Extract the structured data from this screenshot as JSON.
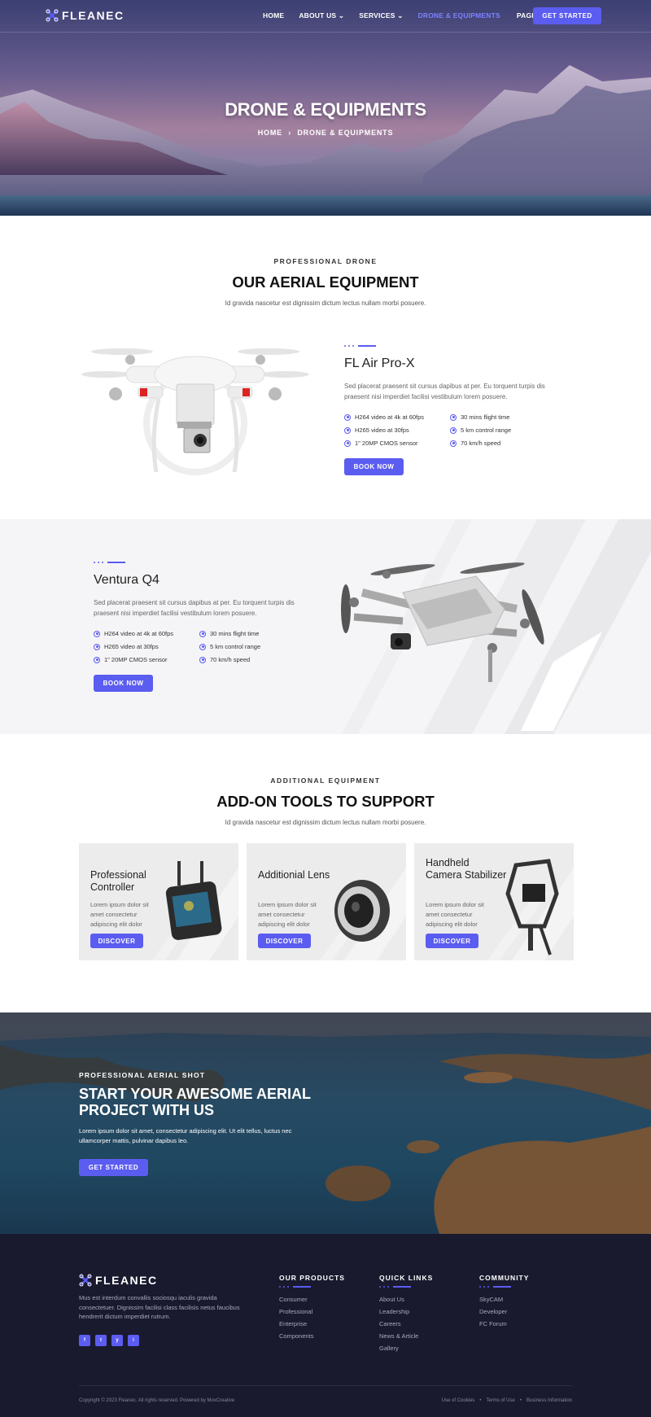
{
  "brand": {
    "name": "FLEANEC"
  },
  "nav": {
    "items": [
      {
        "label": "HOME"
      },
      {
        "label": "ABOUT US",
        "dropdown": true
      },
      {
        "label": "SERVICES",
        "dropdown": true
      },
      {
        "label": "DRONE & EQUIPMENTS",
        "active": true
      },
      {
        "label": "PAGES",
        "dropdown": true
      }
    ],
    "cta": "GET STARTED"
  },
  "hero": {
    "title": "DRONE & EQUIPMENTS",
    "breadcrumb": {
      "home": "HOME",
      "sep": "›",
      "current": "DRONE & EQUIPMENTS"
    }
  },
  "aerial": {
    "kicker": "PROFESSIONAL DRONE",
    "title": "OUR AERIAL EQUIPMENT",
    "subtitle": "Id gravida nascetur est dignissim dictum lectus nullam morbi posuere."
  },
  "products": [
    {
      "title": "FL Air Pro-X",
      "desc": "Sed placerat praesent sit cursus dapibus at per. Eu torquent turpis dis praesent nisi imperdiet facilisi vestibulum lorem posuere.",
      "features": [
        "H264 video at 4k at 60fps",
        "30 mins flight time",
        "H265 video at 30fps",
        "5 km control range",
        "1\" 20MP CMOS sensor",
        "70 km/h speed"
      ],
      "button": "BOOK NOW"
    },
    {
      "title": "Ventura Q4",
      "desc": "Sed placerat praesent sit cursus dapibus at per. Eu torquent turpis dis praesent nisi imperdiet facilisi vestibulum lorem posuere.",
      "features": [
        "H264 video at 4k at 60fps",
        "30 mins flight time",
        "H265 video at 30fps",
        "5 km control range",
        "1\" 20MP CMOS sensor",
        "70 km/h speed"
      ],
      "button": "BOOK NOW"
    }
  ],
  "addons": {
    "kicker": "ADDITIONAL EQUIPMENT",
    "title": "ADD-ON TOOLS TO SUPPORT",
    "subtitle": "Id gravida nascetur est dignissim dictum lectus nullam morbi posuere.",
    "cards": [
      {
        "title": "Professional Controller",
        "desc": "Lorem ipsum dolor sit amet consectetur adipiscing elit dolor",
        "button": "DISCOVER"
      },
      {
        "title": "Additionial Lens",
        "desc": "Lorem ipsum dolor sit amet consectetur adipiscing elit dolor",
        "button": "DISCOVER"
      },
      {
        "title": "Handheld Camera Stabilizer",
        "desc": "Lorem ipsum dolor sit amet consectetur adipiscing elit dolor",
        "button": "DISCOVER"
      }
    ]
  },
  "cta": {
    "kicker": "PROFESSIONAL AERIAL SHOT",
    "title": "START YOUR AWESOME AERIAL PROJECT WITH US",
    "desc": "Lorem ipsum dolor sit amet, consectetur adipiscing elit. Ut elit tellus, luctus nec ullamcorper mattis, pulvinar dapibus leo.",
    "button": "GET STARTED"
  },
  "footer": {
    "desc": "Mus est interdum convallis sociosqu iaculis gravida consectetuer. Dignissim facilisi class facilisis netus faucibus hendrerit dictum imperdiet rutrum.",
    "social": [
      "f",
      "t",
      "y",
      "i"
    ],
    "columns": [
      {
        "title": "OUR PRODUCTS",
        "links": [
          "Consumer",
          "Professional",
          "Enterprise",
          "Components"
        ]
      },
      {
        "title": "QUICK LINKS",
        "links": [
          "About Us",
          "Leadership",
          "Careers",
          "News & Article",
          "Gallery"
        ]
      },
      {
        "title": "COMMUNITY",
        "links": [
          "SkyCAM",
          "Developer",
          "FC Forum"
        ]
      }
    ],
    "copyright": "Copyright © 2023 Fleanec. All rights reserved. Powered by MoxCreative",
    "legal": [
      "Use of Cookies",
      "Terms of Use",
      "Business Information"
    ]
  },
  "colors": {
    "accent": "#5b5cf0",
    "footer_bg": "#191a2e",
    "active_nav": "#7b83ff"
  }
}
